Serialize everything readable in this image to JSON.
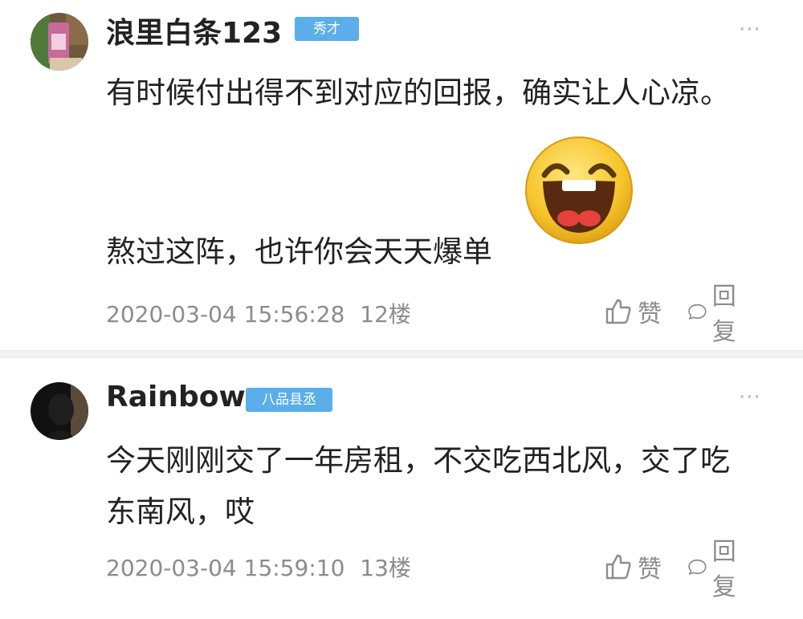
{
  "comments": [
    {
      "username": "浪里白条123",
      "badge": "秀才",
      "more": "···",
      "lines": [
        "有时候付出得不到对应的回报，确实让人心凉。",
        "熬过这阵，也许你会天天爆单"
      ],
      "emoji": "laughing-face",
      "time": "2020-03-04 15:56:28",
      "floor": "12楼",
      "like_label": "赞",
      "reply_label": "回复"
    },
    {
      "username": "Rainbow",
      "badge": "八品县丞",
      "more": "···",
      "lines": [
        "今天刚刚交了一年房租，不交吃西北风，交了吃",
        "东南风，哎"
      ],
      "time": "2020-03-04 15:59:10",
      "floor": "13楼",
      "like_label": "赞",
      "reply_label": "回复"
    }
  ],
  "colors": {
    "badge_bg": "#5aaeea",
    "meta_text": "#8c8c8c",
    "body_text": "#222222",
    "divider": "#f3f3f3"
  }
}
